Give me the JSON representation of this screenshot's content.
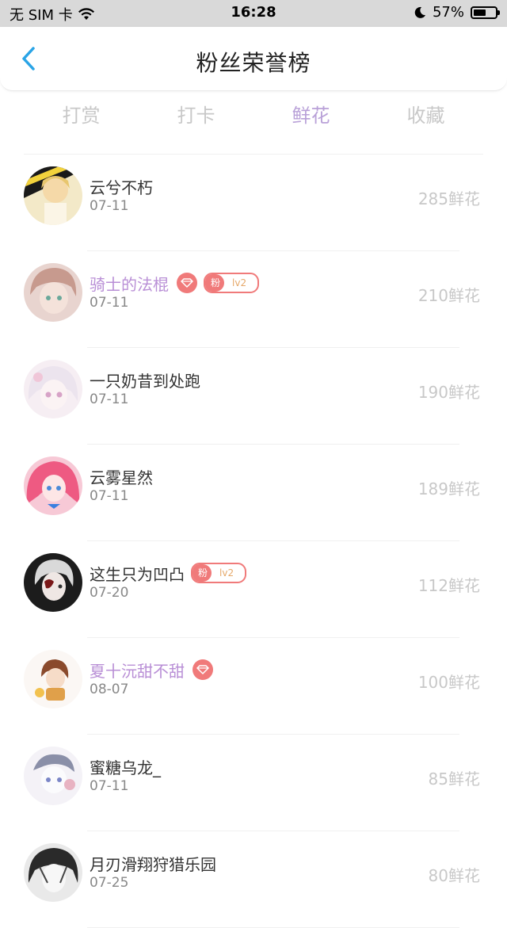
{
  "status_bar": {
    "carrier": "无 SIM 卡",
    "time": "16:28",
    "battery": "57%",
    "battery_level": 0.57
  },
  "header": {
    "title": "粉丝荣誉榜"
  },
  "tabs": [
    {
      "label": "打赏",
      "active": false
    },
    {
      "label": "打卡",
      "active": false
    },
    {
      "label": "鲜花",
      "active": true
    },
    {
      "label": "收藏",
      "active": false
    }
  ],
  "colors": {
    "accent": "#b9a1d8",
    "highlight_name": "#b98fd6",
    "badge": "#f07a7a",
    "muted": "#c8c8c8"
  },
  "list": [
    {
      "name": "云兮不朽",
      "date": "07-11",
      "count": "285鲜花",
      "highlight": false,
      "diamond": false,
      "fan_badge": false
    },
    {
      "name": "骑士的法棍",
      "date": "07-11",
      "count": "210鲜花",
      "highlight": true,
      "diamond": true,
      "fan_badge": true,
      "fan_label": "粉",
      "fan_level": "lv2"
    },
    {
      "name": "一只奶昔到处跑",
      "date": "07-11",
      "count": "190鲜花",
      "highlight": false,
      "diamond": false,
      "fan_badge": false
    },
    {
      "name": "云雾星然",
      "date": "07-11",
      "count": "189鲜花",
      "highlight": false,
      "diamond": false,
      "fan_badge": false
    },
    {
      "name": "这生只为凹凸",
      "date": "07-20",
      "count": "112鲜花",
      "highlight": false,
      "diamond": false,
      "fan_badge": true,
      "fan_label": "粉",
      "fan_level": "lv2"
    },
    {
      "name": "夏十沅甜不甜",
      "date": "08-07",
      "count": "100鲜花",
      "highlight": true,
      "diamond": true,
      "fan_badge": false
    },
    {
      "name": "蜜糖乌龙_",
      "date": "07-11",
      "count": "85鲜花",
      "highlight": false,
      "diamond": false,
      "fan_badge": false
    },
    {
      "name": "月刃滑翔狩猎乐园",
      "date": "07-25",
      "count": "80鲜花",
      "highlight": false,
      "diamond": false,
      "fan_badge": false
    }
  ]
}
